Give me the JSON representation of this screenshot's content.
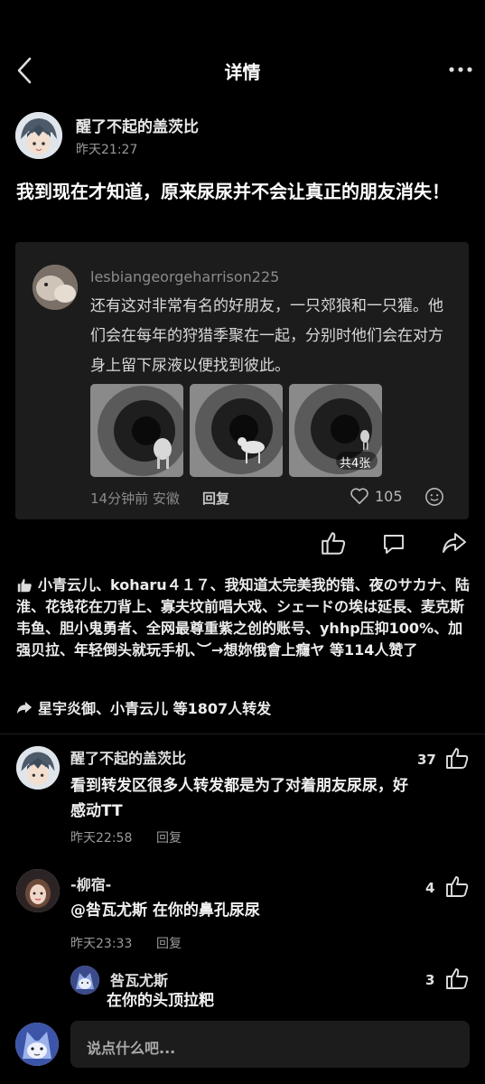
{
  "header": {
    "title": "详情"
  },
  "post": {
    "author": "醒了不起的盖茨比",
    "time": "昨天21:27",
    "text": "我到现在才知道，原来尿尿并不会让真正的朋友消失！",
    "quoted": {
      "username": "lesbiangeorgeharrison225",
      "text": "还有这对非常有名的好朋友，一只郊狼和一只獾。他们会在每年的狩猎季聚在一起，分别时他们会在对方身上留下尿液以便找到彼此。",
      "image_badge": "共4张",
      "meta": "14分钟前 安徽",
      "reply_label": "回复",
      "like_count": "105"
    }
  },
  "likes_text": "小青云儿、koharu４１７、我知道太完美我的错、夜のサカナ、陆淮、花钱花在刀背上、寡夫坟前唱大戏、シェードの埃は延長、麦克斯韦鱼、胆小鬼勇者、全网最尊重紫之创的账号、yhhp压抑100%、加强贝拉、年轻倒头就玩手机、︶→想妳俄會上癮ヤ 等114人赞了",
  "reposts_text": "星宇炎御、小青云儿 等1807人转发",
  "comments": [
    {
      "name": "醒了不起的盖茨比",
      "text": "看到转发区很多人转发都是为了对着朋友尿尿，好感动TT",
      "time": "昨天22:58",
      "reply": "回复",
      "likes": "37"
    },
    {
      "name": "-柳宿-",
      "text": "@咎瓦尤斯 在你的鼻孔尿尿",
      "time": "昨天23:33",
      "reply": "回复",
      "likes": "4"
    }
  ],
  "subreply": {
    "name": "咎瓦尤斯",
    "text": "在你的头顶拉粑",
    "likes": "3"
  },
  "composer": {
    "placeholder": "说点什么吧..."
  }
}
